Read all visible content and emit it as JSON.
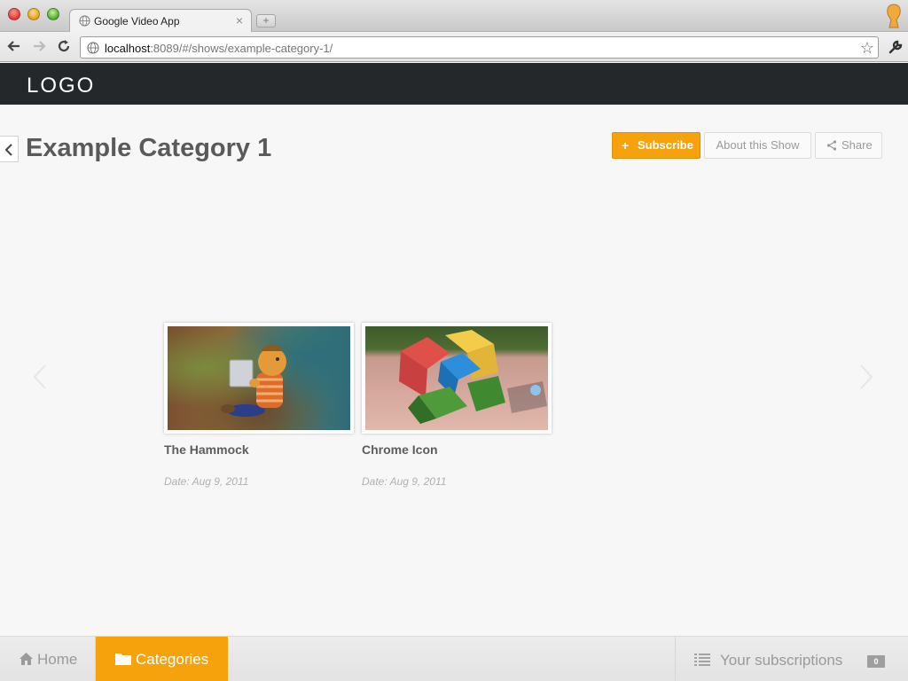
{
  "browser": {
    "tab_title": "Google Video App",
    "tab_close": "×",
    "new_tab": "+",
    "url_host": "localhost",
    "url_rest": ":8089/#/shows/example-category-1/"
  },
  "app": {
    "logo": "LOGO"
  },
  "page": {
    "title": "Example Category 1",
    "actions": {
      "subscribe_icon": "+",
      "subscribe_label": "Subscribe",
      "about_label": "About this Show",
      "share_label": "Share"
    }
  },
  "videos": [
    {
      "title": "The Hammock",
      "date": "Date: Aug 9, 2011"
    },
    {
      "title": "Chrome Icon",
      "date": "Date: Aug 9, 2011"
    }
  ],
  "bottom_nav": {
    "home_label": "Home",
    "categories_label": "Categories",
    "subscriptions_label": "Your subscriptions",
    "subscriptions_count": "0"
  },
  "colors": {
    "accent": "#f5a20c",
    "header_bg": "#24282b",
    "page_bg": "#f7f7f7",
    "title_text": "#5a5a5a"
  },
  "icons": {
    "back": "chevron-left-icon",
    "share": "share-icon",
    "home": "home-icon",
    "categories": "folder-icon",
    "subscriptions": "list-icon"
  }
}
